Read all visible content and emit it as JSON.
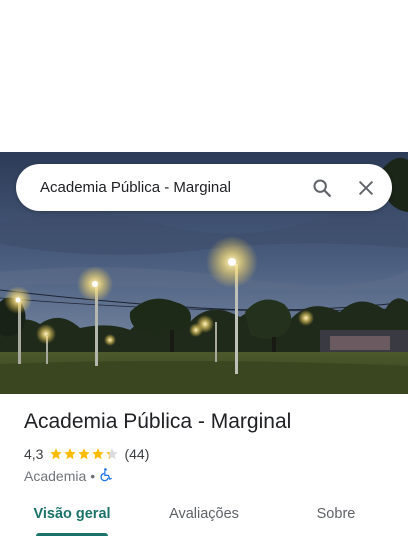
{
  "search": {
    "query": "Academia Pública - Marginal",
    "search_icon": "search-icon",
    "close_icon": "close-icon"
  },
  "photo": {
    "subject": "park-at-dusk-photo"
  },
  "place": {
    "name": "Academia Pública - Marginal",
    "rating": "4,3",
    "rating_value": 4.3,
    "review_count": "(44)",
    "category": "Academia",
    "separator": "•",
    "accessibility_icon": "wheelchair-icon"
  },
  "tabs": [
    {
      "label": "Visão geral",
      "active": true
    },
    {
      "label": "Avaliações",
      "active": false
    },
    {
      "label": "Sobre",
      "active": false
    }
  ],
  "colors": {
    "accent": "#1a7368",
    "star": "#fbbc04",
    "accessibility": "#1a73e8"
  }
}
